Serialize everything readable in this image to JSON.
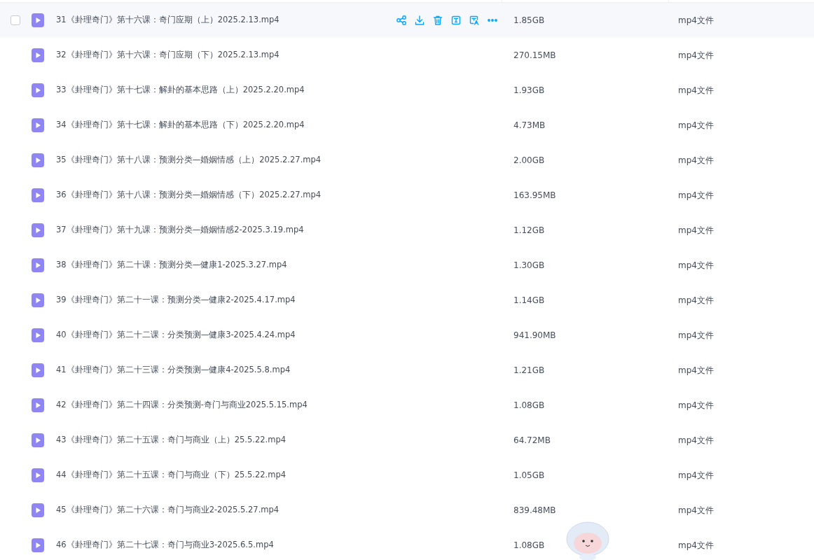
{
  "files": [
    {
      "name": "31《卦理奇门》第十六课：奇门应期（上）2025.2.13.mp4",
      "size": "1.85GB",
      "type": "mp4文件",
      "hovered": true
    },
    {
      "name": "32《卦理奇门》第十六课：奇门应期（下）2025.2.13.mp4",
      "size": "270.15MB",
      "type": "mp4文件",
      "hovered": false
    },
    {
      "name": "33《卦理奇门》第十七课：解卦的基本思路（上）2025.2.20.mp4",
      "size": "1.93GB",
      "type": "mp4文件",
      "hovered": false
    },
    {
      "name": "34《卦理奇门》第十七课：解卦的基本思路（下）2025.2.20.mp4",
      "size": "4.73MB",
      "type": "mp4文件",
      "hovered": false
    },
    {
      "name": "35《卦理奇门》第十八课：预测分类—婚姻情感（上）2025.2.27.mp4",
      "size": "2.00GB",
      "type": "mp4文件",
      "hovered": false
    },
    {
      "name": "36《卦理奇门》第十八课：预测分类—婚姻情感（下）2025.2.27.mp4",
      "size": "163.95MB",
      "type": "mp4文件",
      "hovered": false
    },
    {
      "name": "37《卦理奇门》第十九课：预测分类—婚姻情感2-2025.3.19.mp4",
      "size": "1.12GB",
      "type": "mp4文件",
      "hovered": false
    },
    {
      "name": "38《卦理奇门》第二十课：预测分类—健康1-2025.3.27.mp4",
      "size": "1.30GB",
      "type": "mp4文件",
      "hovered": false
    },
    {
      "name": "39《卦理奇门》第二十一课：预测分类—健康2-2025.4.17.mp4",
      "size": "1.14GB",
      "type": "mp4文件",
      "hovered": false
    },
    {
      "name": "40《卦理奇门》第二十二课：分类预测—健康3-2025.4.24.mp4",
      "size": "941.90MB",
      "type": "mp4文件",
      "hovered": false
    },
    {
      "name": "41《卦理奇门》第二十三课：分类预测—健康4-2025.5.8.mp4",
      "size": "1.21GB",
      "type": "mp4文件",
      "hovered": false
    },
    {
      "name": "42《卦理奇门》第二十四课：分类预测-奇门与商业2025.5.15.mp4",
      "size": "1.08GB",
      "type": "mp4文件",
      "hovered": false
    },
    {
      "name": "43《卦理奇门》第二十五课：奇门与商业（上）25.5.22.mp4",
      "size": "64.72MB",
      "type": "mp4文件",
      "hovered": false
    },
    {
      "name": "44《卦理奇门》第二十五课：奇门与商业（下）25.5.22.mp4",
      "size": "1.05GB",
      "type": "mp4文件",
      "hovered": false
    },
    {
      "name": "45《卦理奇门》第二十六课：奇门与商业2-2025.5.27.mp4",
      "size": "839.48MB",
      "type": "mp4文件",
      "hovered": false
    },
    {
      "name": "46《卦理奇门》第二十七课：奇门与商业3-2025.6.5.mp4",
      "size": "1.08GB",
      "type": "mp4文件",
      "hovered": false
    }
  ]
}
